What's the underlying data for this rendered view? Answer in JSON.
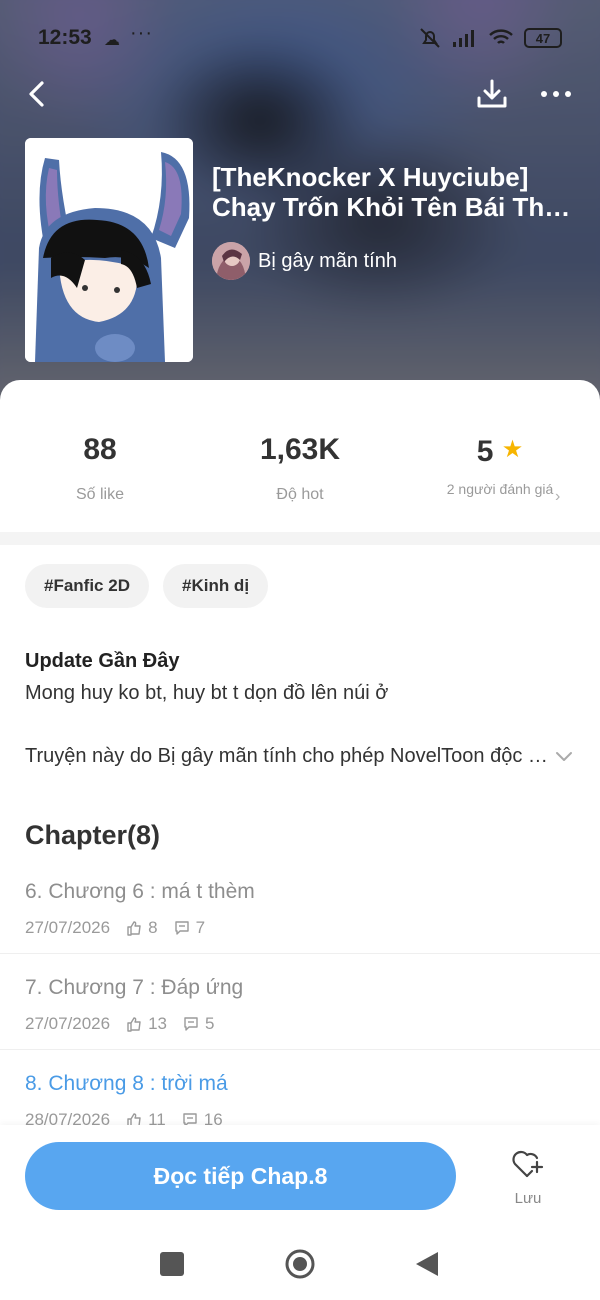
{
  "status_bar": {
    "time": "12:53",
    "battery": "47"
  },
  "book": {
    "title_line1": "[TheKnocker X Huyciube]",
    "title_line2": "Chạy Trốn Khỏi Tên Bái Thi...",
    "author": "Bị gây mãn tính"
  },
  "stats": [
    {
      "value": "88",
      "label": "Số like"
    },
    {
      "value": "1,63K",
      "label": "Độ hot"
    },
    {
      "value": "5",
      "label": "2 người đánh giá"
    }
  ],
  "tags": [
    "#Fanfic 2D",
    "#Kinh dị"
  ],
  "update": {
    "title": "Update Gần Đây",
    "text": "Mong huy ko bt, huy bt t dọn đồ lên núi ở"
  },
  "license_text": "Truyện này do Bị gây mãn tính cho phép NovelToon độc quyền",
  "chapter_header": "Chapter(8)",
  "chapters": [
    {
      "title": "6. Chương 6 : má t thèm",
      "date": "27/07/2026",
      "likes": "8",
      "comments": "7",
      "active": false
    },
    {
      "title": "7. Chương 7 : Đáp ứng",
      "date": "27/07/2026",
      "likes": "13",
      "comments": "5",
      "active": false
    },
    {
      "title": "8. Chương 8 : trời má",
      "date": "28/07/2026",
      "likes": "11",
      "comments": "16",
      "active": true
    }
  ],
  "actions": {
    "read_label": "Đọc tiếp Chap.8",
    "save_label": "Lưu"
  },
  "colors": {
    "accent": "#58a6f0",
    "active_chapter": "#4a9be6",
    "star": "#f7b500"
  }
}
